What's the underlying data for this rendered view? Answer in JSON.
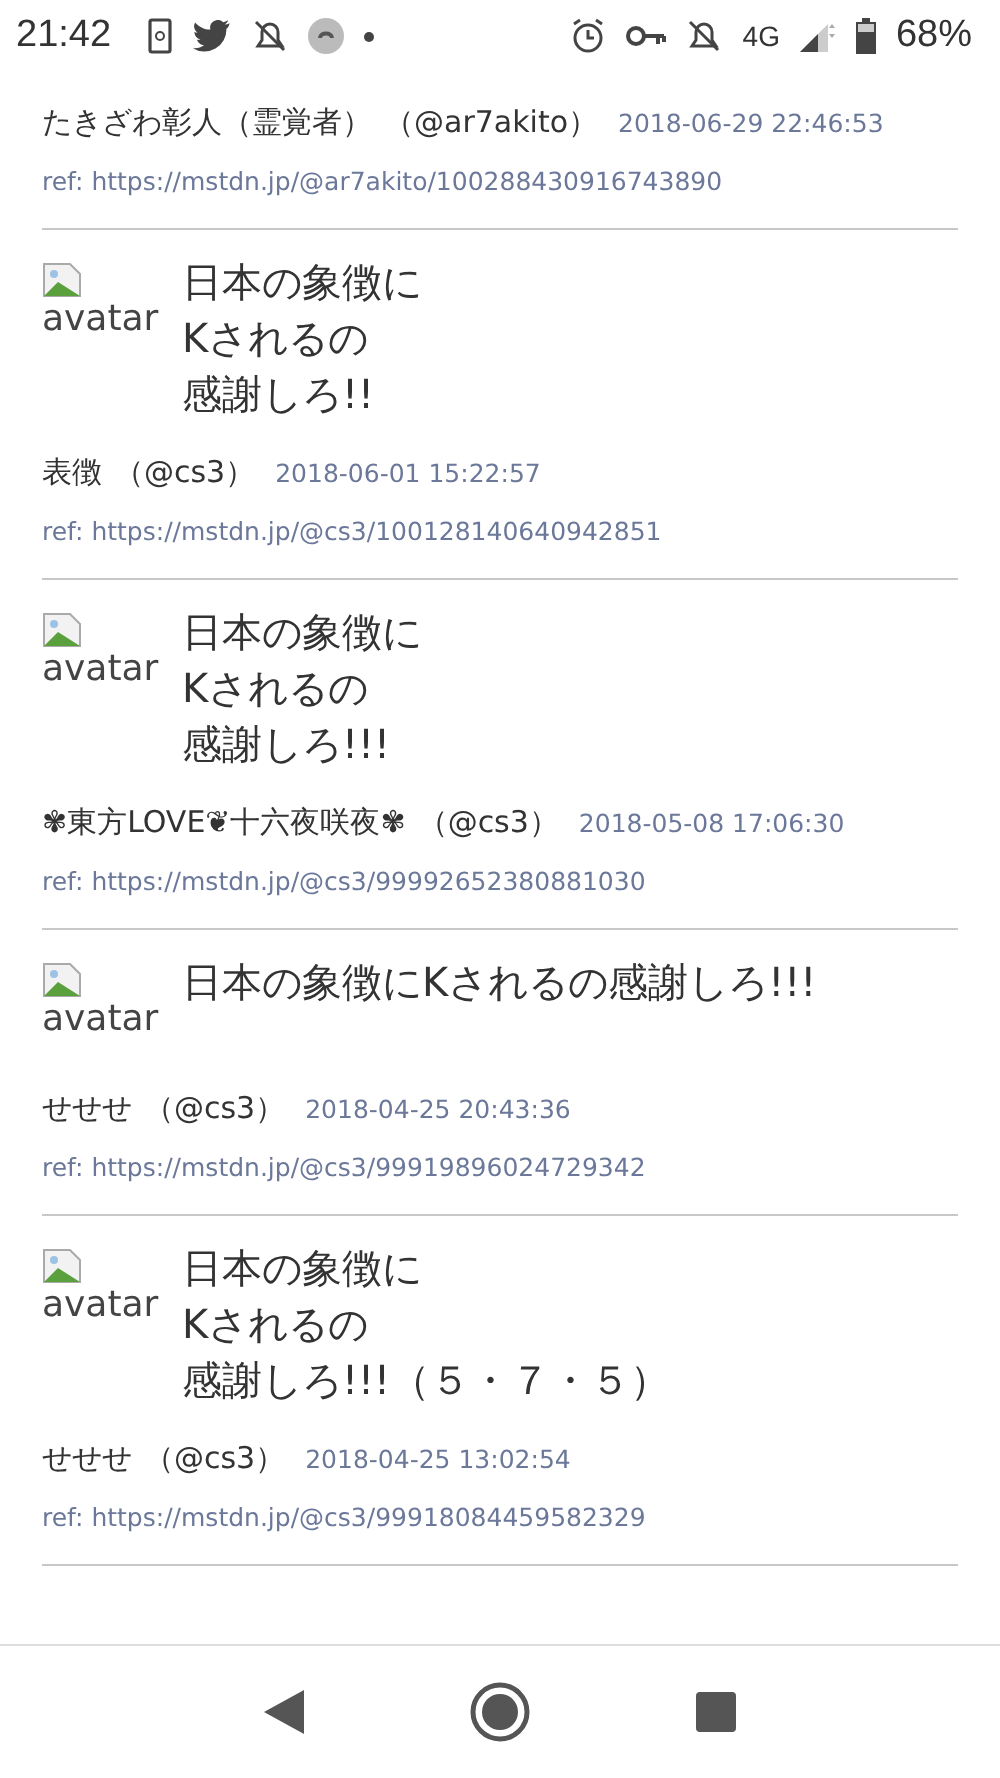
{
  "status_bar": {
    "time": "21:42",
    "network": "4G",
    "battery": "68%"
  },
  "partial_post": {
    "author": "たきざわ彰人（霊覚者）",
    "handle": "（@ar7akito）",
    "date": "2018-06-29 22:46:53",
    "ref": "ref: https://mstdn.jp/@ar7akito/100288430916743890"
  },
  "posts": [
    {
      "avatar_alt": "avatar",
      "lines": [
        "日本の象徴に",
        "Kされるの",
        "感謝しろ!!"
      ],
      "author": "表徴",
      "handle": "（@cs3）",
      "date": "2018-06-01 15:22:57",
      "ref": "ref: https://mstdn.jp/@cs3/100128140640942851"
    },
    {
      "avatar_alt": "avatar",
      "lines": [
        "日本の象徴に",
        "Kされるの",
        "感謝しろ!!!"
      ],
      "author": "✾東方LOVE❦十六夜咲夜✾",
      "handle": "（@cs3）",
      "date": "2018-05-08 17:06:30",
      "ref": "ref: https://mstdn.jp/@cs3/99992652380881030"
    },
    {
      "avatar_alt": "avatar",
      "lines": [
        "日本の象徴にKされるの感謝しろ!!!"
      ],
      "author": "せせせ",
      "handle": "（@cs3）",
      "date": "2018-04-25 20:43:36",
      "ref": "ref: https://mstdn.jp/@cs3/99919896024729342"
    },
    {
      "avatar_alt": "avatar",
      "lines": [
        "日本の象徴に",
        "Kされるの",
        "感謝しろ!!!（５・７・５）"
      ],
      "author": "せせせ",
      "handle": "（@cs3）",
      "date": "2018-04-25 13:02:54",
      "ref": "ref: https://mstdn.jp/@cs3/99918084459582329"
    }
  ]
}
